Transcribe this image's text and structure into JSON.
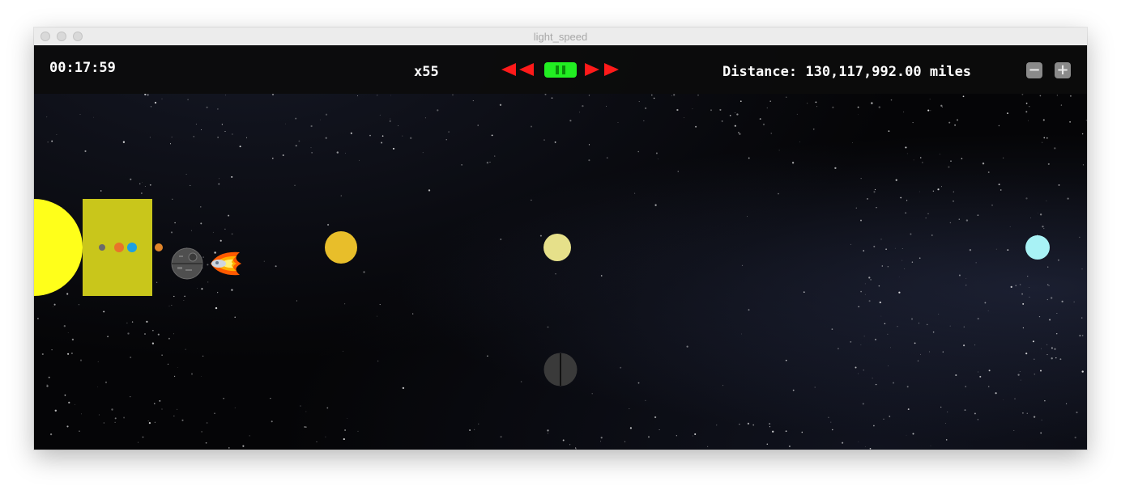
{
  "window": {
    "title": "light_speed"
  },
  "hud": {
    "elapsed_time": "00:17:59",
    "speed_multiplier": "x55",
    "distance_text": "Distance: 130,117,992.00 miles",
    "zoom_out_label": "−",
    "zoom_in_label": "+"
  },
  "controls": {
    "rewind_icon": "double-left-triangle-icon",
    "pause_icon": "pause-icon",
    "fast_forward_icon": "double-right-triangle-icon",
    "control_color": "#ff1a1a",
    "pause_color": "#22ee22"
  },
  "scene": {
    "bodies": [
      {
        "name": "sun",
        "color": "#ffff1a"
      },
      {
        "name": "mercury",
        "color": "#6b6b6b"
      },
      {
        "name": "venus",
        "color": "#e8742a"
      },
      {
        "name": "earth",
        "color": "#1ea0e0"
      },
      {
        "name": "mars",
        "color": "#e0852a"
      },
      {
        "name": "death-star",
        "color": "#555555"
      },
      {
        "name": "jupiter",
        "color": "#e8be2a"
      },
      {
        "name": "saturn",
        "color": "#e6e08a"
      },
      {
        "name": "uranus",
        "color": "#a8f2f5"
      },
      {
        "name": "dark-moon",
        "color": "#3a3a3a"
      }
    ],
    "inner_system_highlight_color": "#c9c61b"
  }
}
